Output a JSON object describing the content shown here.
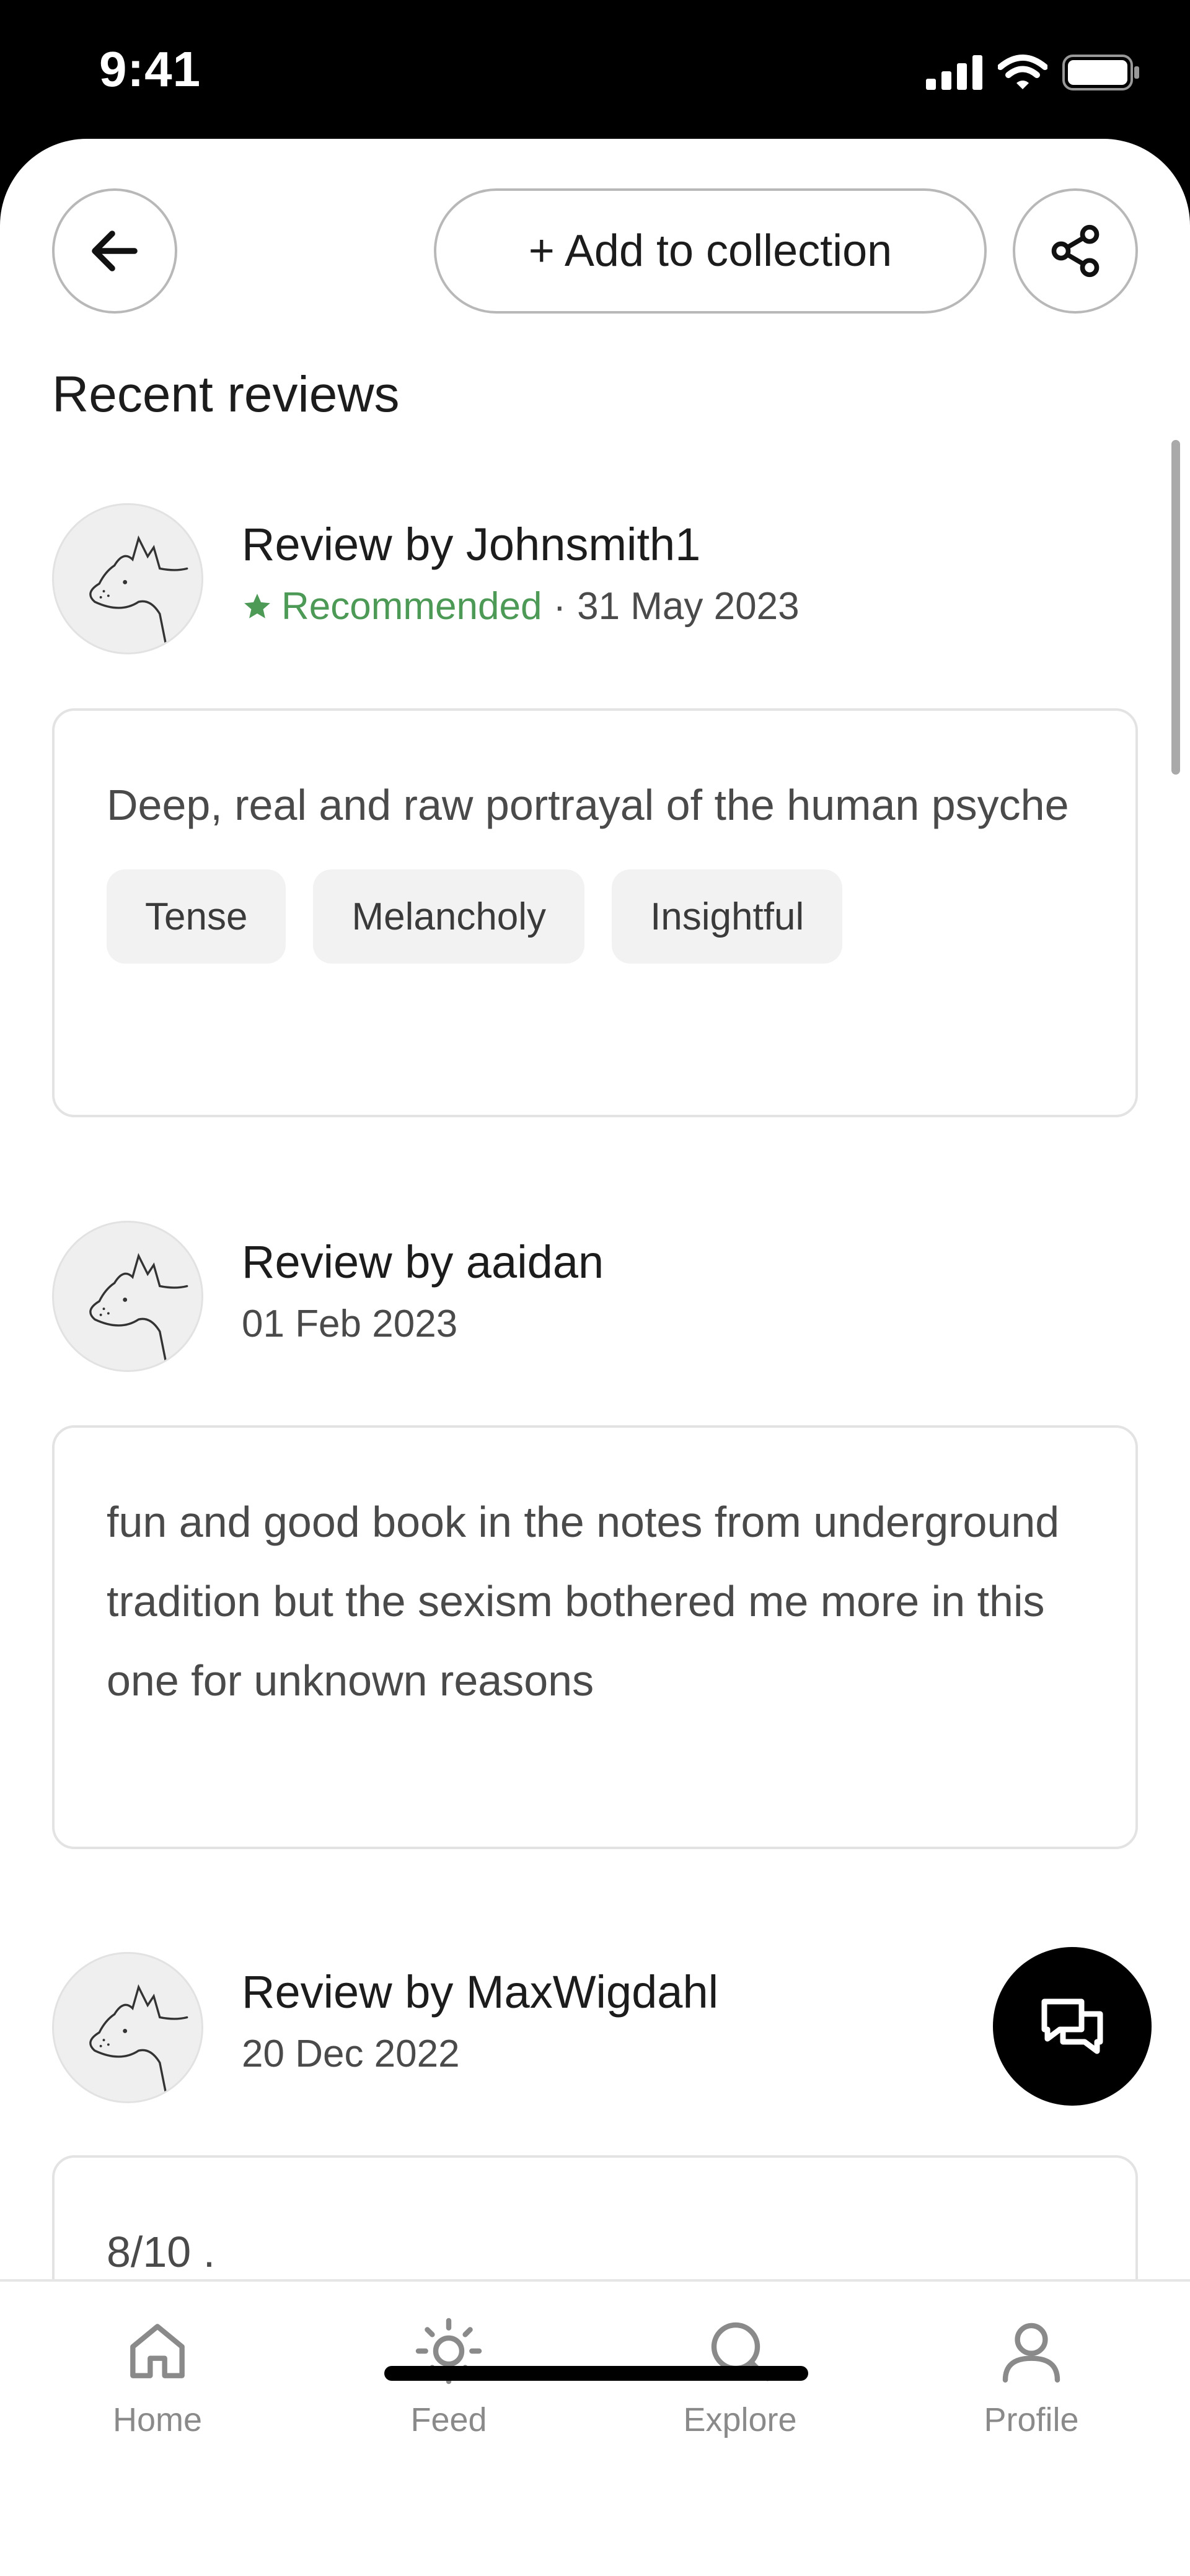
{
  "status_bar": {
    "time": "9:41"
  },
  "header": {
    "add_label": "+ Add to collection"
  },
  "section_title": "Recent reviews",
  "reviews": [
    {
      "reviewer": "Review by Johnsmith1",
      "recommended": "Recommended",
      "date": "31 May 2023",
      "text": "Deep, real and raw portrayal of the human psyche",
      "tags": [
        "Tense",
        "Melancholy",
        "Insightful"
      ]
    },
    {
      "reviewer": "Review by aaidan",
      "date": "01 Feb 2023",
      "text": "fun and good book in the notes from underground tradition but the sexism bothered me more in this one for unknown reasons"
    },
    {
      "reviewer": "Review by MaxWigdahl",
      "date": "20 Dec 2022",
      "text": "8/10 ."
    }
  ],
  "tabs": [
    {
      "label": "Home",
      "icon": "home-icon"
    },
    {
      "label": "Feed",
      "icon": "sun-icon"
    },
    {
      "label": "Explore",
      "icon": "search-icon"
    },
    {
      "label": "Profile",
      "icon": "user-icon"
    }
  ],
  "colors": {
    "recommended": "#4c9a56",
    "tab_inactive": "#8a8a8a",
    "fab": "#000000"
  }
}
